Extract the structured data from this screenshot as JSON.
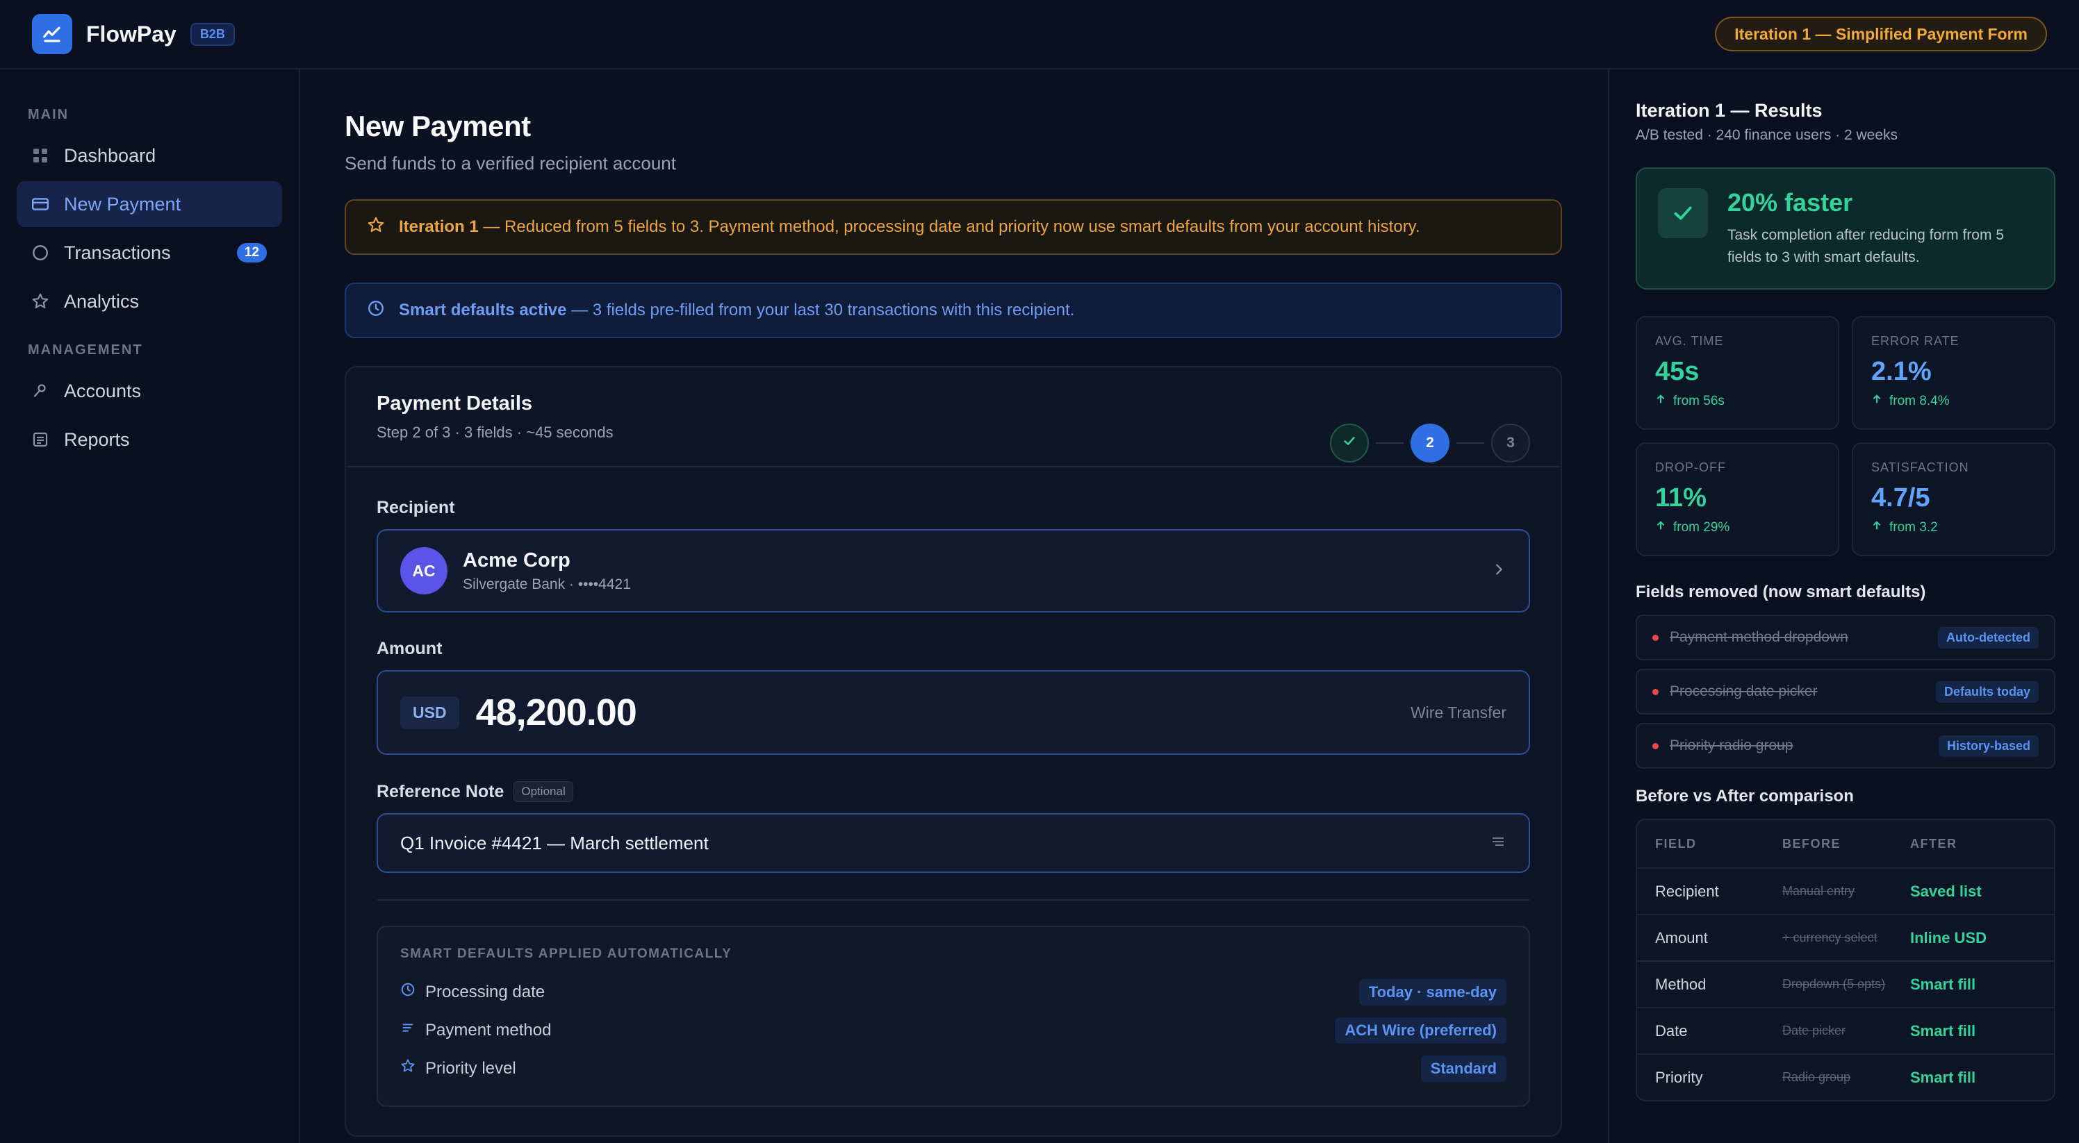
{
  "brand": {
    "name": "FlowPay",
    "badge": "B2B"
  },
  "header": {
    "iteration_pill": "Iteration 1 — Simplified Payment Form"
  },
  "sidebar": {
    "main_label": "MAIN",
    "management_label": "MANAGEMENT",
    "items": [
      {
        "label": "Dashboard",
        "icon": "grid-icon"
      },
      {
        "label": "New Payment",
        "icon": "card-icon",
        "active": true
      },
      {
        "label": "Transactions",
        "icon": "circle-icon",
        "badge": "12"
      },
      {
        "label": "Analytics",
        "icon": "star-icon"
      },
      {
        "label": "Accounts",
        "icon": "key-icon"
      },
      {
        "label": "Reports",
        "icon": "report-icon"
      }
    ]
  },
  "page": {
    "title": "New Payment",
    "subtitle": "Send funds to a verified recipient account"
  },
  "banners": {
    "iteration": {
      "bold": "Iteration 1",
      "text": " — Reduced from 5 fields to 3. Payment method, processing date and priority now use smart defaults from your account history."
    },
    "smart": {
      "bold": "Smart defaults active",
      "text": " — 3 fields pre-filled from your last 30 transactions with this recipient."
    }
  },
  "form": {
    "title": "Payment Details",
    "subtitle": "Step 2 of 3 · 3 fields · ~45 seconds",
    "steps": [
      "✓",
      "2",
      "3"
    ],
    "recipient": {
      "label": "Recipient",
      "initials": "AC",
      "name": "Acme Corp",
      "detail": "Silvergate Bank · ••••4421"
    },
    "amount": {
      "label": "Amount",
      "currency": "USD",
      "value": "48,200.00",
      "method": "Wire Transfer"
    },
    "note": {
      "label": "Reference Note",
      "optional": "Optional",
      "value": "Q1 Invoice #4421 — March settlement"
    },
    "defaults": {
      "title": "SMART DEFAULTS APPLIED AUTOMATICALLY",
      "rows": [
        {
          "label": "Processing date",
          "value": "Today · same-day",
          "icon": "clock-icon"
        },
        {
          "label": "Payment method",
          "value": "ACH Wire (preferred)",
          "icon": "lines-icon"
        },
        {
          "label": "Priority level",
          "value": "Standard",
          "icon": "star-icon"
        }
      ]
    }
  },
  "results": {
    "title": "Iteration 1 — Results",
    "subtitle": "A/B tested · 240 finance users · 2 weeks",
    "hero": {
      "big": "20% faster",
      "text": "Task completion after reducing form from 5 fields to 3 with smart defaults."
    },
    "metrics": [
      {
        "label": "AVG. TIME",
        "value": "45s",
        "delta": "from 56s",
        "color": "green"
      },
      {
        "label": "ERROR RATE",
        "value": "2.1%",
        "delta": "from 8.4%",
        "color": "blue"
      },
      {
        "label": "DROP-OFF",
        "value": "11%",
        "delta": "from 29%",
        "color": "green"
      },
      {
        "label": "SATISFACTION",
        "value": "4.7/5",
        "delta": "from 3.2",
        "color": "blue"
      }
    ],
    "removed_title": "Fields removed (now smart defaults)",
    "removed": [
      {
        "label": "Payment method dropdown",
        "tag": "Auto-detected"
      },
      {
        "label": "Processing date picker",
        "tag": "Defaults today"
      },
      {
        "label": "Priority radio group",
        "tag": "History-based"
      }
    ],
    "comparison_title": "Before vs After comparison",
    "comparison_head": [
      "FIELD",
      "BEFORE",
      "AFTER"
    ],
    "comparison": [
      {
        "field": "Recipient",
        "before": "Manual entry",
        "after": "Saved list"
      },
      {
        "field": "Amount",
        "before": "+ currency select",
        "after": "Inline USD"
      },
      {
        "field": "Method",
        "before": "Dropdown (5 opts)",
        "after": "Smart fill"
      },
      {
        "field": "Date",
        "before": "Date picker",
        "after": "Smart fill"
      },
      {
        "field": "Priority",
        "before": "Radio group",
        "after": "Smart fill"
      }
    ]
  },
  "colors": {
    "accent": "#2f6fe4",
    "success": "#34d399",
    "warning": "#f2a93b",
    "background": "#0b1120"
  }
}
